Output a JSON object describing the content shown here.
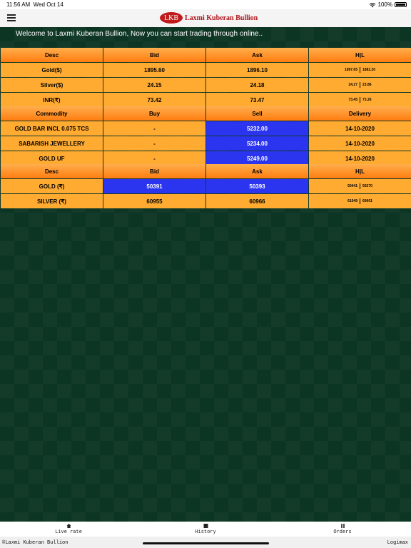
{
  "status_bar": {
    "time": "11:56 AM",
    "date": "Wed Oct 14",
    "battery": "100%"
  },
  "header": {
    "logo_text": "LKB",
    "brand": "Laxmi Kuberan Bullion"
  },
  "marquee": "Welcome to Laxmi Kuberan Bullion, Now you can start trading through online..",
  "spot_table": {
    "headers": [
      "Desc",
      "Bid",
      "Ask",
      "H|L"
    ],
    "rows": [
      {
        "desc": "Gold($)",
        "bid": "1895.60",
        "ask": "1896.10",
        "high": "1897.65",
        "low": "1882.20"
      },
      {
        "desc": "Silver($)",
        "bid": "24.15",
        "ask": "24.18",
        "high": "24.27",
        "low": "23.86"
      },
      {
        "desc": "INR(₹)",
        "bid": "73.42",
        "ask": "73.47",
        "high": "73.45",
        "low": "73.26"
      }
    ]
  },
  "commodity_table": {
    "headers": [
      "Commodity",
      "Buy",
      "Sell",
      "Delivery"
    ],
    "rows": [
      {
        "name": "GOLD BAR INCL 0.075 TCS",
        "buy": "-",
        "sell": "5232.00",
        "delivery": "14-10-2020"
      },
      {
        "name": "SABARISH JEWELLERY",
        "buy": "-",
        "sell": "5234.00",
        "delivery": "14-10-2020"
      },
      {
        "name": "GOLD UF",
        "buy": "-",
        "sell": "5249.00",
        "delivery": "14-10-2020"
      }
    ]
  },
  "local_table": {
    "headers": [
      "Desc",
      "Bid",
      "Ask",
      "H|L"
    ],
    "rows": [
      {
        "desc": "GOLD (₹)",
        "bid": "50391",
        "ask": "50393",
        "high": "50441",
        "low": "50270"
      },
      {
        "desc": "SILVER (₹)",
        "bid": "60955",
        "ask": "60966",
        "high": "61049",
        "low": "60601"
      }
    ]
  },
  "tabs": [
    {
      "label": "Live rate",
      "icon": "home-icon"
    },
    {
      "label": "History",
      "icon": "history-icon"
    },
    {
      "label": "Orders",
      "icon": "orders-icon"
    }
  ],
  "footer": {
    "copyright": "©Laxmi Kuberan Bullion",
    "credit": "Logimax"
  },
  "colors": {
    "accent_orange": "#ff7d10",
    "cell_orange": "#ffab32",
    "highlight_blue": "#2b35f0",
    "background_green": "#0d3524",
    "brand_red": "#c01b1b"
  }
}
